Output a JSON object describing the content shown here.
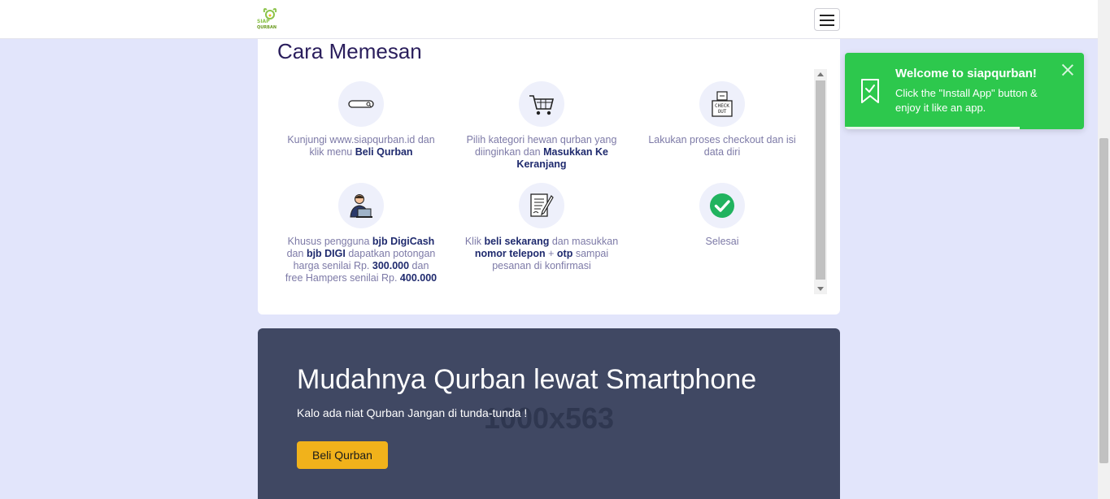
{
  "navbar": {
    "logo_text_top": "SIAP",
    "logo_text_bottom": "QURBAN",
    "menu_icon": "hamburger-icon"
  },
  "how_to_order": {
    "title": "Cara Memesan",
    "steps": [
      {
        "icon": "search-bar-icon",
        "parts": [
          [
            "Kunjungi www.siapqurban.id dan klik menu ",
            false
          ],
          [
            "Beli Qurban",
            true
          ]
        ]
      },
      {
        "icon": "shopping-cart-icon",
        "parts": [
          [
            "Pilih kategori hewan qurban yang diinginkan dan ",
            false
          ],
          [
            "Masukkan Ke Keranjang",
            true
          ]
        ]
      },
      {
        "icon": "checkout-box-icon",
        "parts": [
          [
            "Lakukan proses checkout dan isi data diri",
            false
          ]
        ]
      },
      {
        "icon": "user-laptop-icon",
        "parts": [
          [
            "Khusus pengguna ",
            false
          ],
          [
            "bjb DigiCash",
            true
          ],
          [
            " dan ",
            false
          ],
          [
            "bjb DIGI",
            true
          ],
          [
            " dapatkan potongan harga senilai Rp. ",
            false
          ],
          [
            "300.000",
            true
          ],
          [
            " dan free Hampers senilai Rp. ",
            false
          ],
          [
            "400.000",
            true
          ]
        ]
      },
      {
        "icon": "document-sign-icon",
        "parts": [
          [
            "Klik ",
            false
          ],
          [
            "beli sekarang",
            true
          ],
          [
            " dan masukkan ",
            false
          ],
          [
            "nomor telepon",
            true
          ],
          [
            " + ",
            false
          ],
          [
            "otp",
            true
          ],
          [
            " sampai pesanan di konfirmasi",
            false
          ]
        ]
      },
      {
        "icon": "check-circle-icon",
        "parts": [
          [
            "Selesai",
            false
          ]
        ]
      }
    ]
  },
  "hero": {
    "placeholder_text": "1000x563",
    "title": "Mudahnya Qurban lewat Smartphone",
    "subtitle": "Kalo ada niat Qurban Jangan di tunda-tunda !",
    "button_label": "Beli Qurban",
    "background_color": "#404863",
    "button_color": "#f1b21b"
  },
  "toast": {
    "title": "Welcome to siapqurban!",
    "message": "Click the \"Install App\" button & enjoy it like an app.",
    "icon": "bookmark-check-icon",
    "close_icon": "close-icon",
    "progress": 0.73,
    "color": "#2dc84d"
  }
}
